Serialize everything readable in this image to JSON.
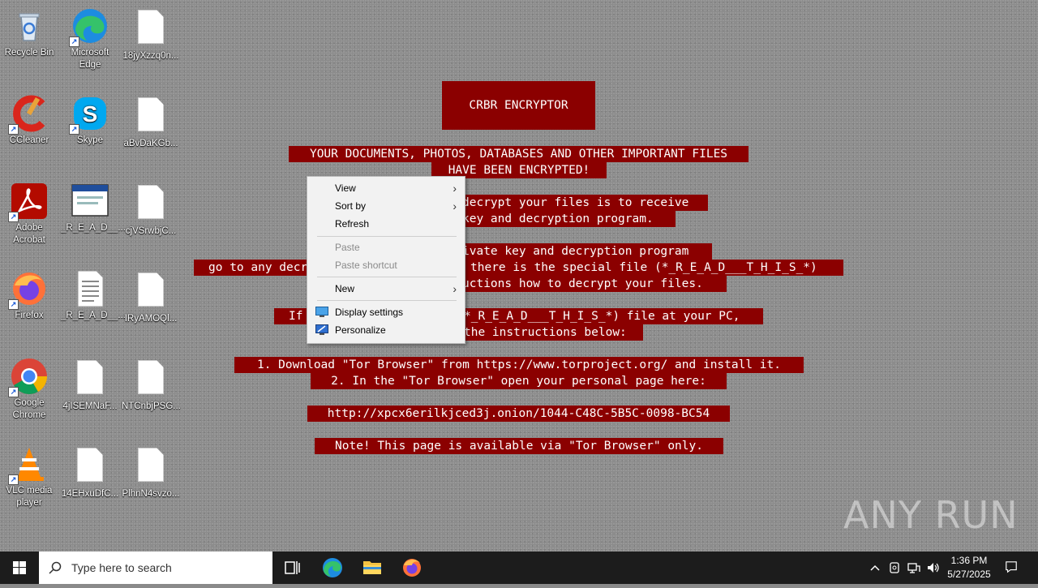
{
  "desktop_icons": [
    {
      "label": "Recycle Bin",
      "icon": "recycle-bin-icon"
    },
    {
      "label": "Microsoft Edge",
      "icon": "edge-icon"
    },
    {
      "label": "18jyXzzq0n...",
      "icon": "file-icon"
    },
    {
      "label": "CCleaner",
      "icon": "ccleaner-icon"
    },
    {
      "label": "Skype",
      "icon": "skype-icon"
    },
    {
      "label": "aBvDaKGb...",
      "icon": "file-icon"
    },
    {
      "label": "Adobe Acrobat",
      "icon": "acrobat-icon"
    },
    {
      "label": "_R_E_A_D__...",
      "icon": "html-file-icon"
    },
    {
      "label": "cjVSrwbjC...",
      "icon": "file-icon"
    },
    {
      "label": "Firefox",
      "icon": "firefox-icon"
    },
    {
      "label": "_R_E_A_D__...",
      "icon": "text-file-icon"
    },
    {
      "label": "IRyAMOQl...",
      "icon": "file-icon"
    },
    {
      "label": "Google Chrome",
      "icon": "chrome-icon"
    },
    {
      "label": "4jISEMNaF...",
      "icon": "file-icon"
    },
    {
      "label": "NTCnbjPSG...",
      "icon": "file-icon"
    },
    {
      "label": "VLC media player",
      "icon": "vlc-icon"
    },
    {
      "label": "14EHxuDfC...",
      "icon": "file-icon"
    },
    {
      "label": "PlhnN4svzo...",
      "icon": "file-icon"
    }
  ],
  "note": {
    "title": "CRBR ENCRYPTOR",
    "line1": "YOUR DOCUMENTS, PHOTOS, DATABASES AND OTHER IMPORTANT FILES",
    "line2": "HAVE BEEN ENCRYPTED!",
    "line3": "decrypt your files is to receive",
    "line4": "key and decryption program.",
    "line5": "ivate key and decryption program",
    "line6a": "go to any decr",
    "line6b": "there is the special file (*_R_E_A_D___T_H_I_S_*)",
    "line7": "uctions how to decrypt your files.",
    "line8a": "If",
    "line8b": "*_R_E_A_D___T_H_I_S_*) file at your PC,",
    "line9": "the instructions below:",
    "step1": "1. Download \"Tor Browser\" from https://www.torproject.org/ and install it.",
    "step2": "2. In the \"Tor Browser\" open your personal page here:",
    "url": "http://xpcx6erilkjced3j.onion/1044-C48C-5B5C-0098-BC54",
    "footer": "Note! This page is available via \"Tor Browser\" only."
  },
  "context_menu": {
    "view": "View",
    "sort_by": "Sort by",
    "refresh": "Refresh",
    "paste": "Paste",
    "paste_shortcut": "Paste shortcut",
    "new": "New",
    "display_settings": "Display settings",
    "personalize": "Personalize"
  },
  "watermark": "ANY RUN",
  "taskbar": {
    "search_placeholder": "Type here to search",
    "time": "1:36 PM",
    "date": "5/27/2025"
  },
  "colors": {
    "note_bg": "#8b0000",
    "taskbar_bg": "#1c1c1c"
  }
}
